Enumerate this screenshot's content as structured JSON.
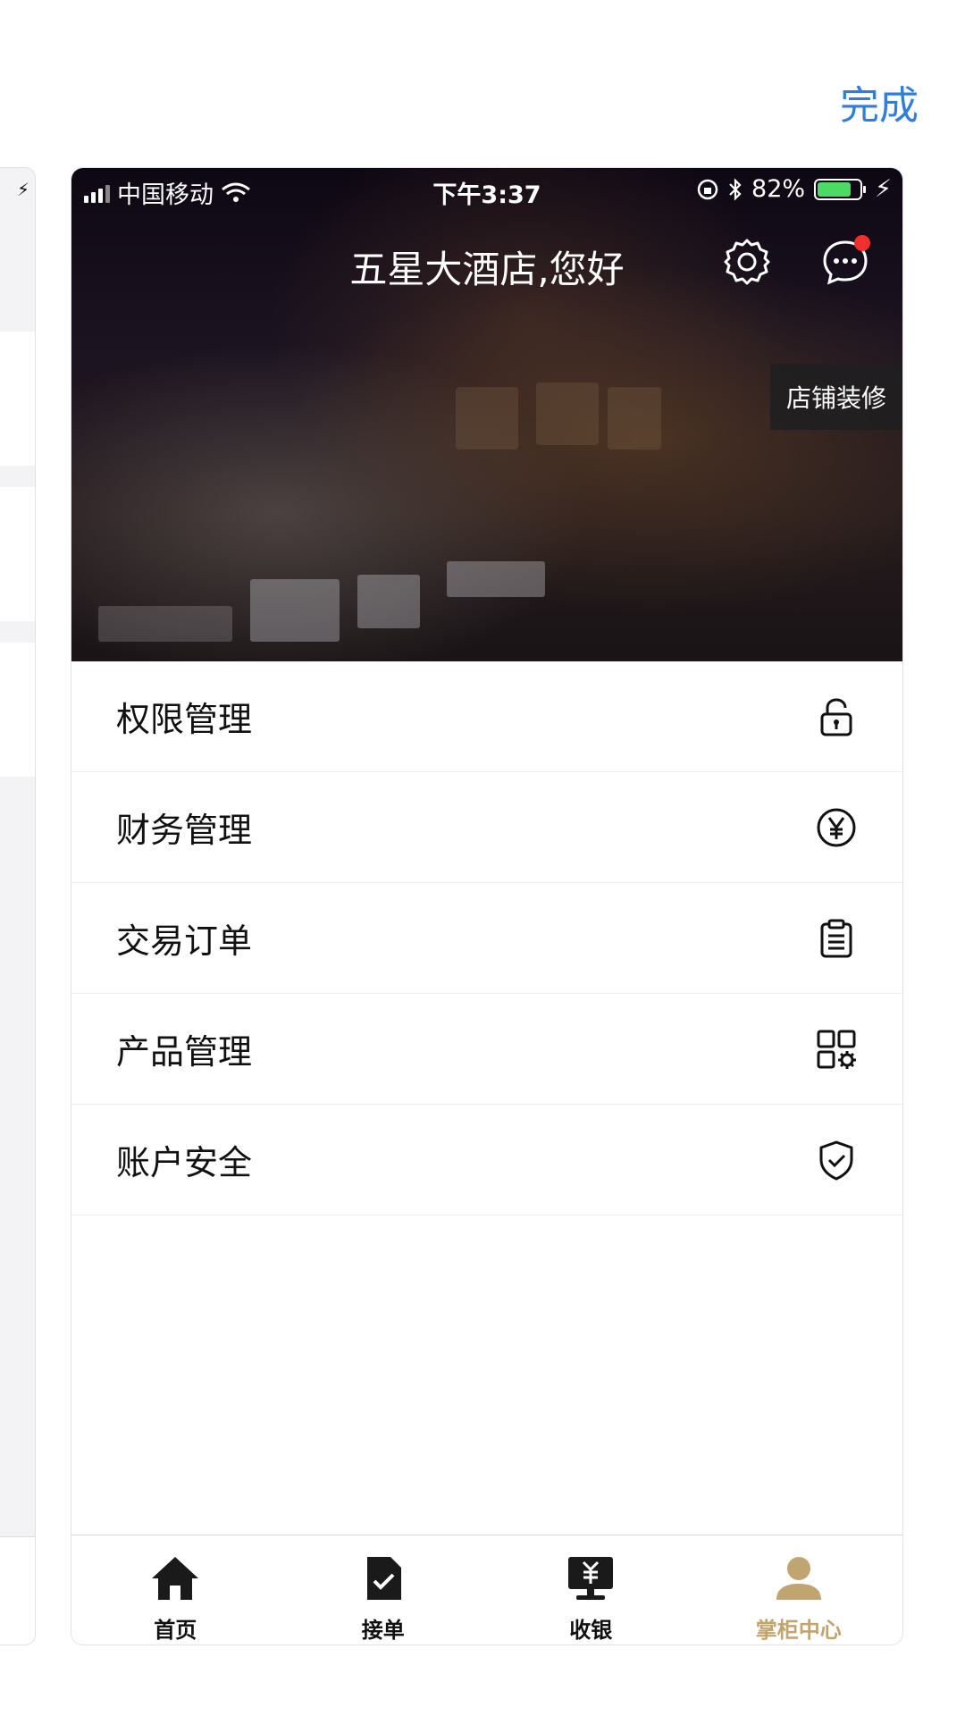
{
  "header": {
    "done_label": "完成"
  },
  "status_bar": {
    "carrier": "中国移动",
    "time": "下午3:37",
    "battery": "82%",
    "battery_level": 0.82
  },
  "hero": {
    "greeting": "五星大酒店,您好",
    "decorate_label": "店铺装修"
  },
  "menu": {
    "items": [
      {
        "label": "权限管理",
        "icon": "lock-icon"
      },
      {
        "label": "财务管理",
        "icon": "yuan-icon"
      },
      {
        "label": "交易订单",
        "icon": "clipboard-icon"
      },
      {
        "label": "产品管理",
        "icon": "grid-settings-icon"
      },
      {
        "label": "账户安全",
        "icon": "shield-check-icon"
      }
    ]
  },
  "tabbar": {
    "tabs": [
      {
        "label": "首页",
        "icon": "home-icon"
      },
      {
        "label": "接单",
        "icon": "order-doc-icon"
      },
      {
        "label": "收银",
        "icon": "cashier-icon"
      },
      {
        "label": "掌柜中心",
        "icon": "person-icon",
        "active": true
      }
    ]
  },
  "colors": {
    "accent": "#2f7ddc",
    "active_tab": "#c1a571",
    "notification": "#f0302a"
  }
}
